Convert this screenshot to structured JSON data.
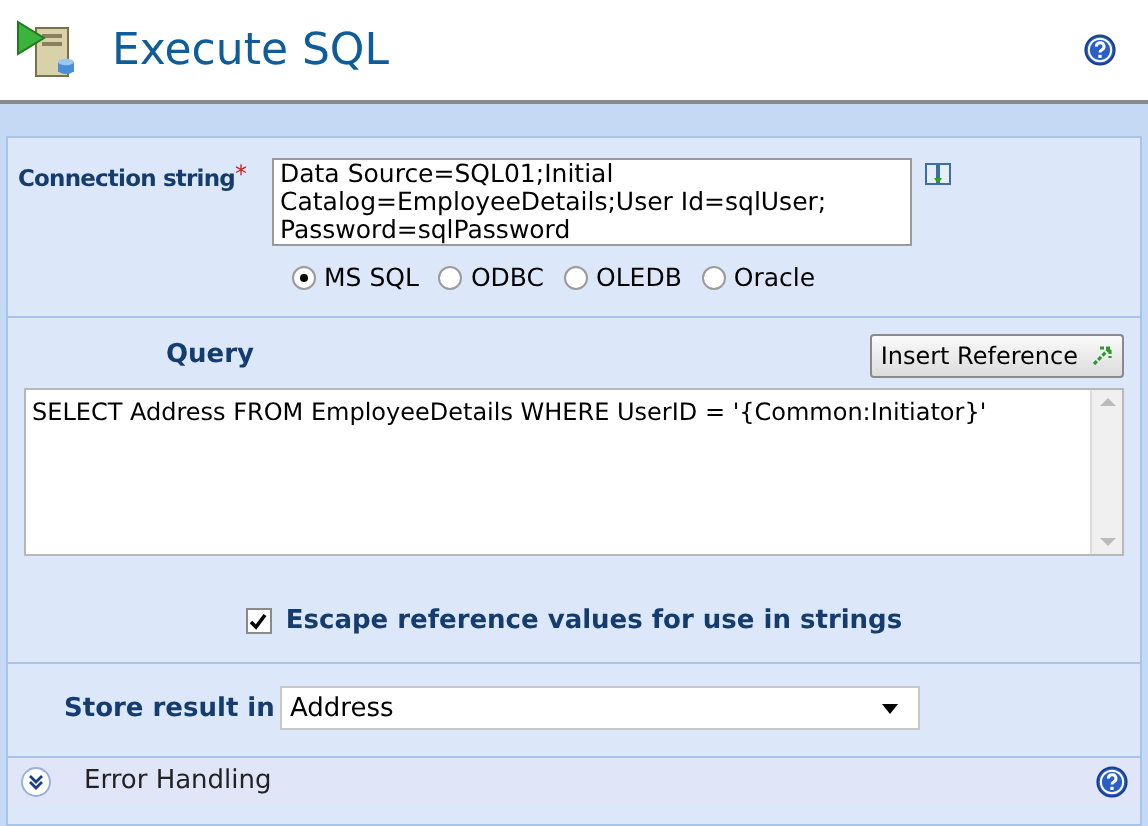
{
  "header": {
    "title": "Execute SQL"
  },
  "connection": {
    "label": "Connection string",
    "required_mark": "*",
    "value": "Data Source=SQL01;Initial Catalog=EmployeeDetails;User Id=sqlUser; Password=sqlPassword",
    "providers": [
      {
        "label": "MS SQL",
        "selected": true
      },
      {
        "label": "ODBC",
        "selected": false
      },
      {
        "label": "OLEDB",
        "selected": false
      },
      {
        "label": "Oracle",
        "selected": false
      }
    ]
  },
  "query": {
    "label": "Query",
    "insert_button": "Insert Reference",
    "value": "SELECT Address FROM EmployeeDetails WHERE UserID = '{Common:Initiator}'"
  },
  "escape_option": {
    "label": "Escape reference values for use in strings",
    "checked": true
  },
  "store_result": {
    "label": "Store result in",
    "value": "Address"
  },
  "error_handling": {
    "label": "Error Handling",
    "expanded": false
  }
}
